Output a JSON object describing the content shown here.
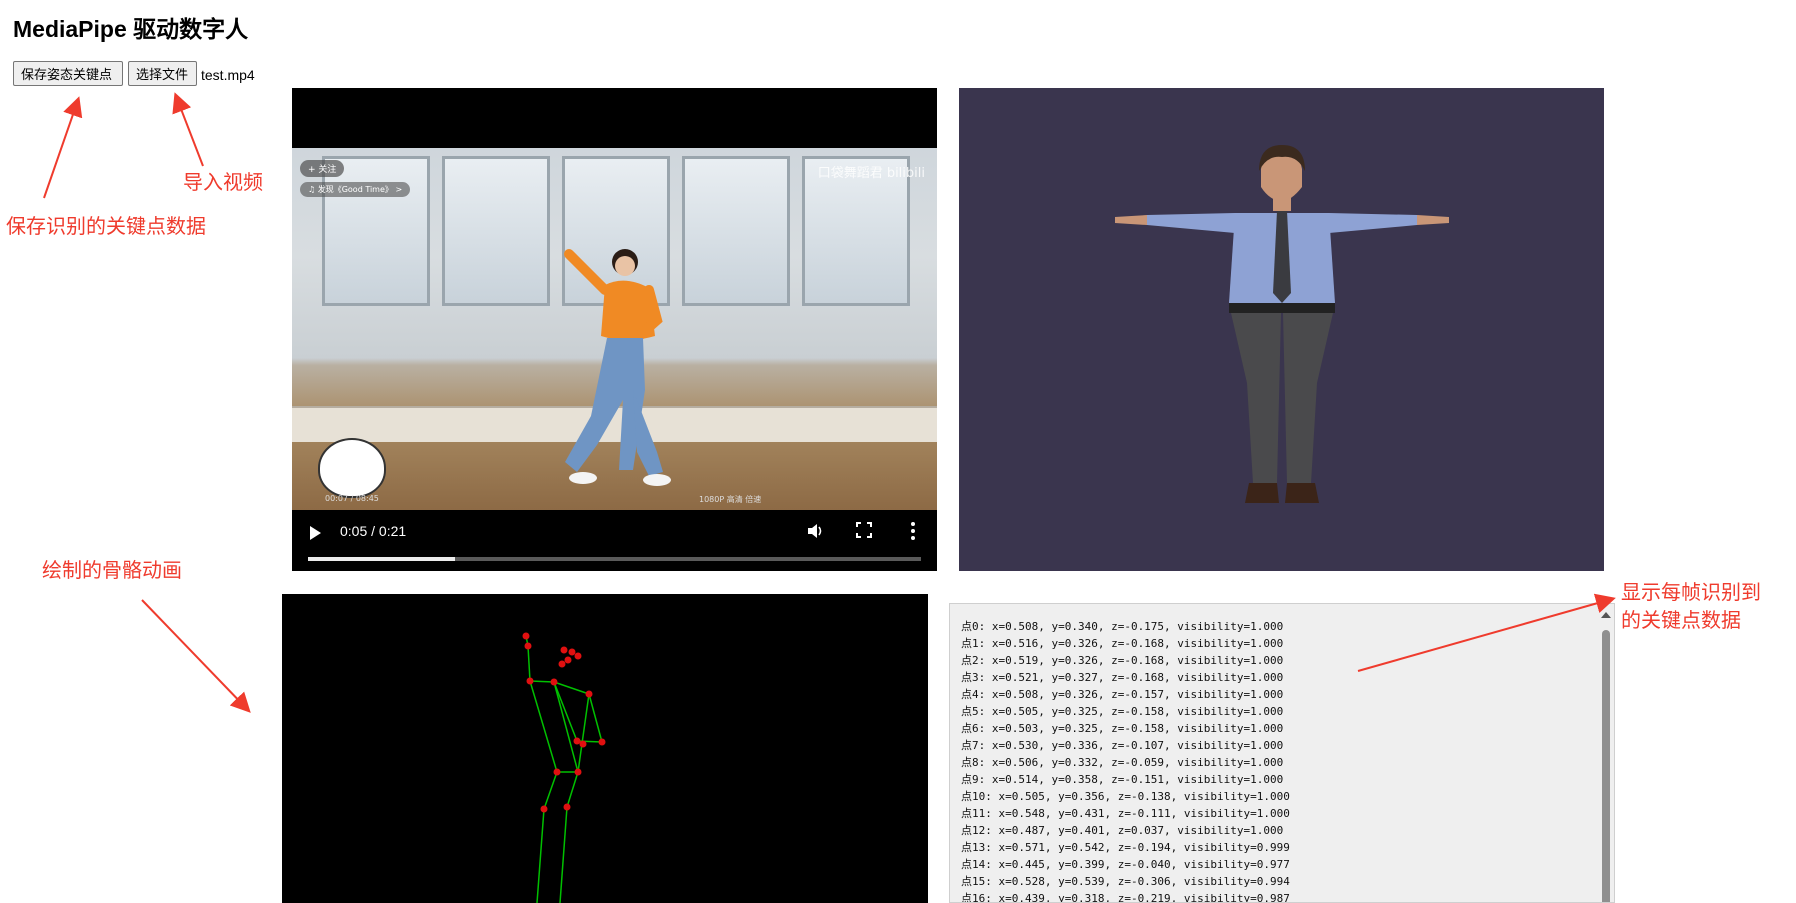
{
  "page": {
    "title": "MediaPipe 驱动数字人"
  },
  "toolbar": {
    "save_label": "保存姿态关键点",
    "choose_file_label": "选择文件",
    "file_name": "test.mp4"
  },
  "annotations": {
    "import_video": "导入视频",
    "save_keypoints": "保存识别的关键点数据",
    "skeleton_animation": "绘制的骨骼动画",
    "per_frame_data_line1": "显示每帧识别到",
    "per_frame_data_line2": "的关键点数据",
    "color": "#ef3b2d"
  },
  "video": {
    "time": "0:05 / 0:21",
    "progress": 0.24,
    "overlay_follow": "+ 关注",
    "overlay_song": "♫ 发现《Good Time》 >",
    "overlay_channel": "口袋舞蹈君 bilibili",
    "overlay_elapsed": "00:07 / 08:45",
    "overlay_quality": "1080P 高清   倍速"
  },
  "model_viewer": {
    "background": "#3a354e"
  },
  "skeleton": {
    "bone_color": "#00c000",
    "joint_color": "#e01010"
  },
  "keypoints": [
    "点0: x=0.508, y=0.340, z=-0.175, visibility=1.000",
    "点1: x=0.516, y=0.326, z=-0.168, visibility=1.000",
    "点2: x=0.519, y=0.326, z=-0.168, visibility=1.000",
    "点3: x=0.521, y=0.327, z=-0.168, visibility=1.000",
    "点4: x=0.508, y=0.326, z=-0.157, visibility=1.000",
    "点5: x=0.505, y=0.325, z=-0.158, visibility=1.000",
    "点6: x=0.503, y=0.325, z=-0.158, visibility=1.000",
    "点7: x=0.530, y=0.336, z=-0.107, visibility=1.000",
    "点8: x=0.506, y=0.332, z=-0.059, visibility=1.000",
    "点9: x=0.514, y=0.358, z=-0.151, visibility=1.000",
    "点10: x=0.505, y=0.356, z=-0.138, visibility=1.000",
    "点11: x=0.548, y=0.431, z=-0.111, visibility=1.000",
    "点12: x=0.487, y=0.401, z=0.037, visibility=1.000",
    "点13: x=0.571, y=0.542, z=-0.194, visibility=0.999",
    "点14: x=0.445, y=0.399, z=-0.040, visibility=0.977",
    "点15: x=0.528, y=0.539, z=-0.306, visibility=0.994",
    "点16: x=0.439, y=0.318, z=-0.219, visibility=0.987"
  ]
}
